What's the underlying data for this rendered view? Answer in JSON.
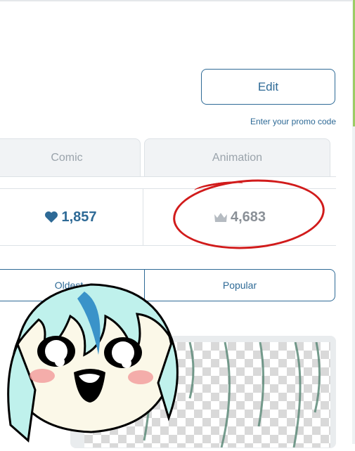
{
  "header": {
    "edit_label": "Edit",
    "promo_label": "Enter your promo code"
  },
  "tabs": [
    {
      "label": "Comic"
    },
    {
      "label": "Animation"
    }
  ],
  "stats": {
    "likes": "1,857",
    "views": "4,683"
  },
  "sort": {
    "oldest": "Oldest",
    "popular": "Popular"
  },
  "colors": {
    "accent": "#2e6a96",
    "annotation_red": "#d11b1b",
    "muted": "#9aa3ab"
  },
  "icons": {
    "likes": "heart-icon",
    "views": "crown-icon"
  }
}
